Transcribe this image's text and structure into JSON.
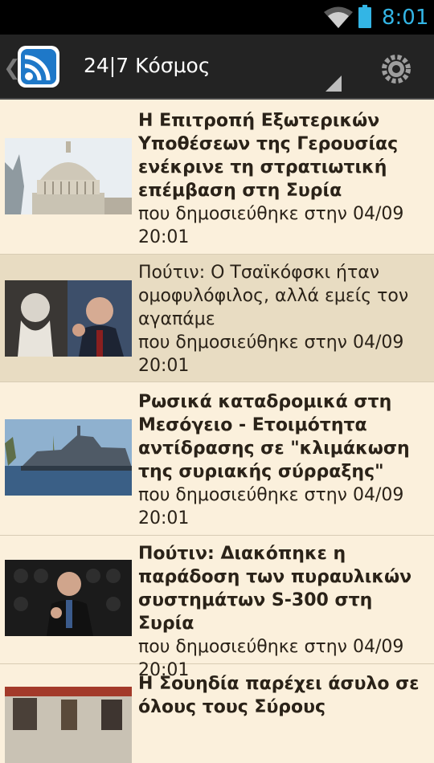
{
  "status_bar": {
    "time": "8:01",
    "icons": [
      "wifi-icon",
      "battery-icon"
    ],
    "accent": "#33b5e5"
  },
  "action_bar": {
    "title": "24|7 Κόσμος",
    "icons": [
      "up-chevron-icon",
      "rss-app-icon",
      "spinner-arrow-icon",
      "settings-icon"
    ]
  },
  "feed": {
    "items": [
      {
        "headline": "Η Επιτροπή Εξωτερικών Υποθέσεων της Γερουσίας ενέκρινε τη στρατιωτική επέμβαση στη Συρία",
        "meta": "που δημοσιεύθηκε στην 04/09 20:01",
        "bold": true,
        "thumbnail": "capitol-building-image"
      },
      {
        "headline": "Πούτιν: Ο Τσαϊκόφσκι ήταν ομοφυλόφιλος, αλλά εμείς τον αγαπάμε",
        "meta": "που δημοσιεύθηκε στην 04/09 20:01",
        "bold": false,
        "selected": true,
        "thumbnail": "tchaikovsky-putin-image"
      },
      {
        "headline": "Ρωσικά καταδρομικά στη Μεσόγειο - Ετοιμότητα αντίδρασης σε \"κλιμάκωση της συριακής σύρραξης\"",
        "meta": "που δημοσιεύθηκε στην 04/09 20:01",
        "bold": true,
        "thumbnail": "warship-image"
      },
      {
        "headline": "Πούτιν: Διακόπηκε η παράδοση των πυραυλικών συστημάτων S-300 στη Συρία",
        "meta": "που δημοσιεύθηκε στην 04/09 20:01",
        "bold": true,
        "thumbnail": "putin-speech-image"
      },
      {
        "headline": "Η Σουηδία παρέχει άσυλο σε όλους τους Σύρους",
        "meta": "",
        "bold": true,
        "thumbnail": "refugees-image"
      }
    ]
  },
  "colors": {
    "background": "#fbf0dc",
    "selected_row": "#e8dcc2",
    "action_bar": "#232323",
    "text": "#2a2218"
  }
}
